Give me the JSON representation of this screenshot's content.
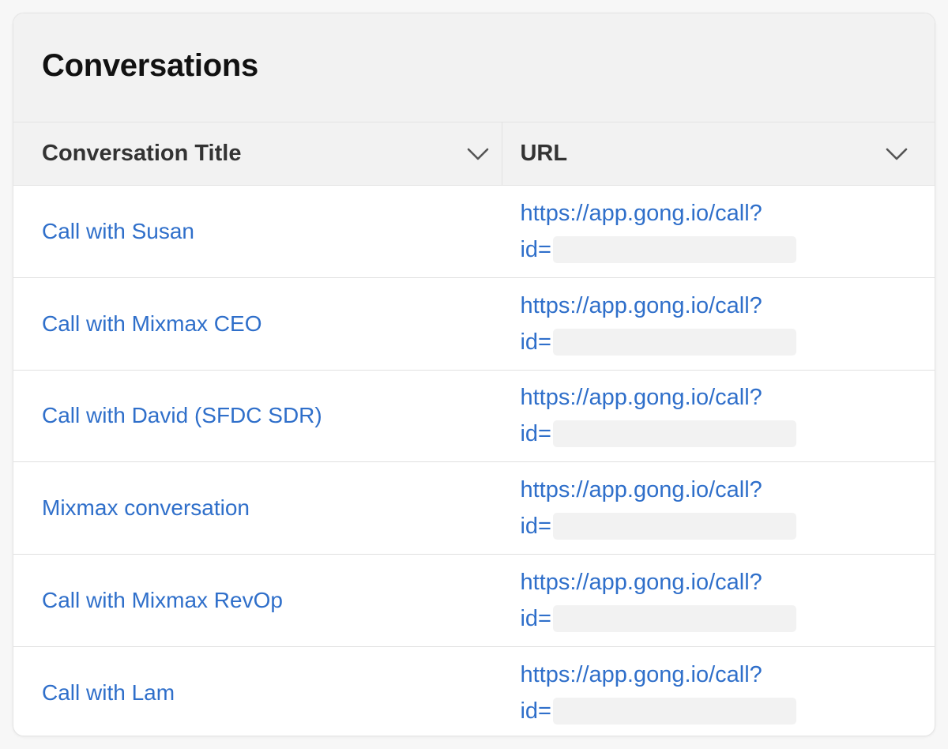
{
  "card": {
    "title": "Conversations"
  },
  "columns": [
    {
      "label": "Conversation Title",
      "sort_icon": "chevron-down-icon"
    },
    {
      "label": "URL",
      "sort_icon": "chevron-down-icon"
    }
  ],
  "rows": [
    {
      "title": "Call with Susan",
      "url_prefix": "https://app.gong.io/call?",
      "url_id_label": "id="
    },
    {
      "title": "Call with Mixmax CEO",
      "url_prefix": "https://app.gong.io/call?",
      "url_id_label": "id="
    },
    {
      "title": "Call with David (SFDC SDR)",
      "url_prefix": "https://app.gong.io/call?",
      "url_id_label": "id="
    },
    {
      "title": "Mixmax conversation",
      "url_prefix": "https://app.gong.io/call?",
      "url_id_label": "id="
    },
    {
      "title": "Call with Mixmax RevOp",
      "url_prefix": "https://app.gong.io/call?",
      "url_id_label": "id="
    },
    {
      "title": "Call with Lam",
      "url_prefix": "https://app.gong.io/call?",
      "url_id_label": "id="
    }
  ],
  "colors": {
    "link": "#2f6fca",
    "header_bg": "#f2f2f2",
    "title_text": "#111111"
  }
}
